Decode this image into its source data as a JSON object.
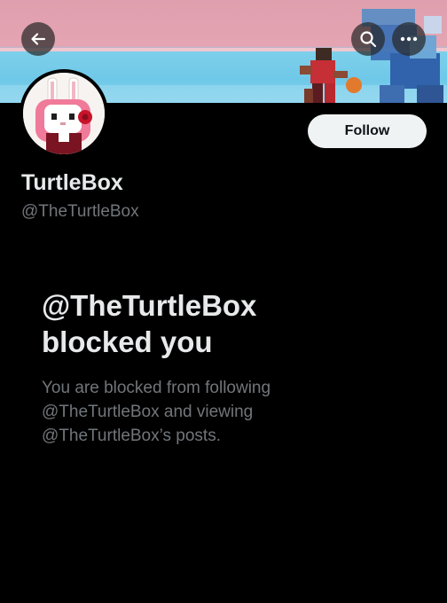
{
  "header": {
    "back_icon": "back-arrow-icon",
    "search_icon": "search-icon",
    "more_icon": "more-horizontal-icon"
  },
  "profile": {
    "display_name": "TurtleBox",
    "handle": "@TheTurtleBox",
    "follow_label": "Follow"
  },
  "blocked": {
    "title_line1": "@TheTurtleBox",
    "title_line2": "blocked you",
    "desc_line1": "You are blocked from following",
    "desc_line2": "@TheTurtleBox and viewing",
    "desc_line3": "@TheTurtleBox’s posts."
  },
  "colors": {
    "background": "#000000",
    "text_primary": "#e7e9ea",
    "text_secondary": "#71767b",
    "follow_button_bg": "#eff3f4"
  }
}
